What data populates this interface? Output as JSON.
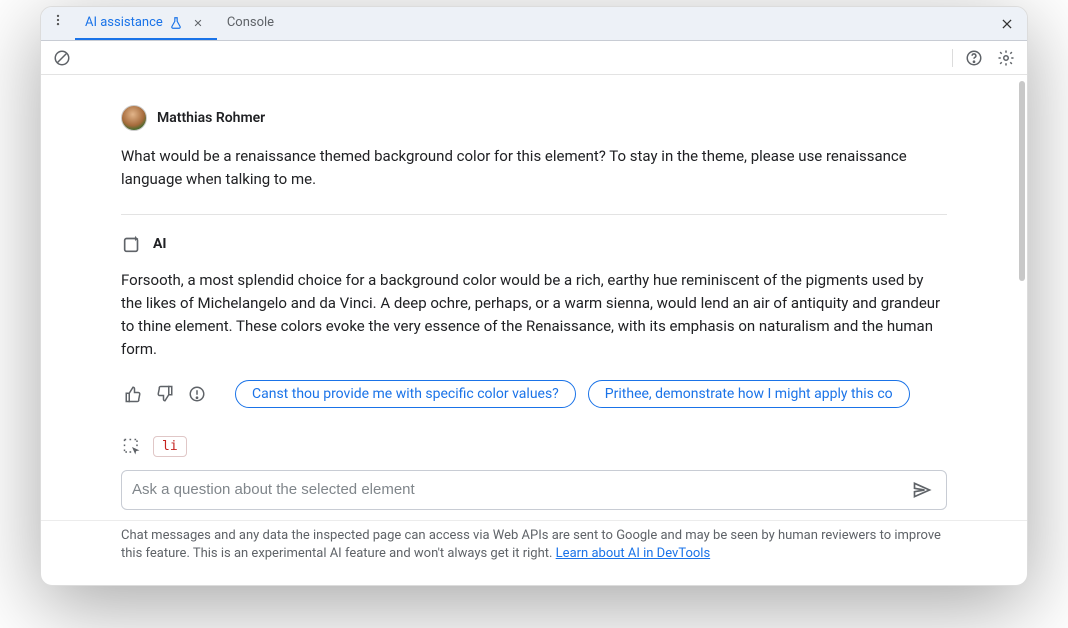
{
  "tabs": {
    "ai": "AI assistance",
    "console": "Console"
  },
  "user": {
    "name": "Matthias Rohmer",
    "message": "What would be a renaissance themed background color for this element? To stay in the theme, please use renaissance language when talking to me."
  },
  "ai": {
    "label": "AI",
    "message": "Forsooth, a most splendid choice for a background color would be a rich, earthy hue reminiscent of the pigments used by the likes of Michelangelo and da Vinci. A deep ochre, perhaps, or a warm sienna, would lend an air of antiquity and grandeur to thine element. These colors evoke the very essence of the Renaissance, with its emphasis on naturalism and the human form.",
    "suggestions": [
      "Canst thou provide me with specific color values?",
      "Prithee, demonstrate how I might apply this co"
    ]
  },
  "selected_element": "li",
  "input": {
    "placeholder": "Ask a question about the selected element"
  },
  "footer": {
    "text": "Chat messages and any data the inspected page can access via Web APIs are sent to Google and may be seen by human reviewers to improve this feature. This is an experimental AI feature and won't always get it right. ",
    "link": "Learn about AI in DevTools"
  },
  "icons": {
    "clear": "clear",
    "help": "help",
    "settings": "settings",
    "close": "close"
  }
}
